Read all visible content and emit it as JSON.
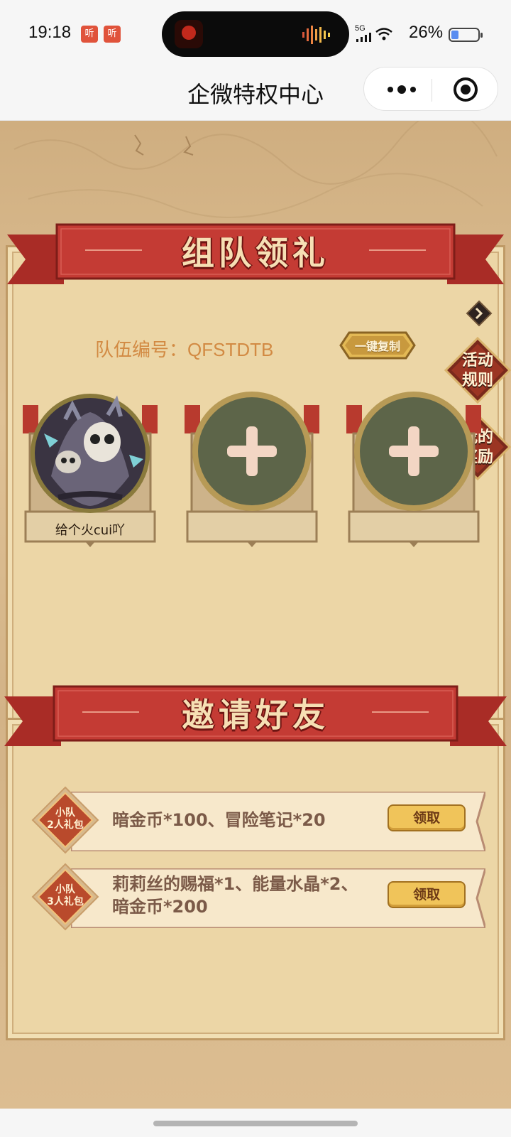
{
  "status": {
    "time": "19:18",
    "badges": [
      "听",
      "听"
    ],
    "network": "5G",
    "battery": "26%",
    "battery_level": 0.26
  },
  "nav": {
    "title": "企微特权中心"
  },
  "team": {
    "heading": "组队领礼",
    "team_label": "队伍编号：",
    "team_code": "QFSTDTB",
    "copy_button": "一键复制",
    "members": [
      {
        "name": "给个火cui吖",
        "filled": true
      },
      {
        "name": "",
        "filled": false
      },
      {
        "name": "",
        "filled": false
      }
    ]
  },
  "side": {
    "rules": [
      "活动",
      "规则"
    ],
    "rewards": [
      "我的",
      "奖励"
    ]
  },
  "invite": {
    "heading": "邀请好友",
    "rewards": [
      {
        "tag": [
          "小队",
          "2人礼包"
        ],
        "lines": [
          "暗金币*100、冒险笔记*20"
        ],
        "button": "领取"
      },
      {
        "tag": [
          "小队",
          "3人礼包"
        ],
        "lines": [
          "莉莉丝的赐福*1、能量水晶*2、",
          "暗金币*200"
        ],
        "button": "领取"
      }
    ]
  },
  "colors": {
    "ribbon_red": "#c43b34",
    "panel_bg": "#ecd6a6",
    "claim_gold": "#f0c45a",
    "slot_green": "#5d6549",
    "team_code_orange": "#d28a43"
  }
}
